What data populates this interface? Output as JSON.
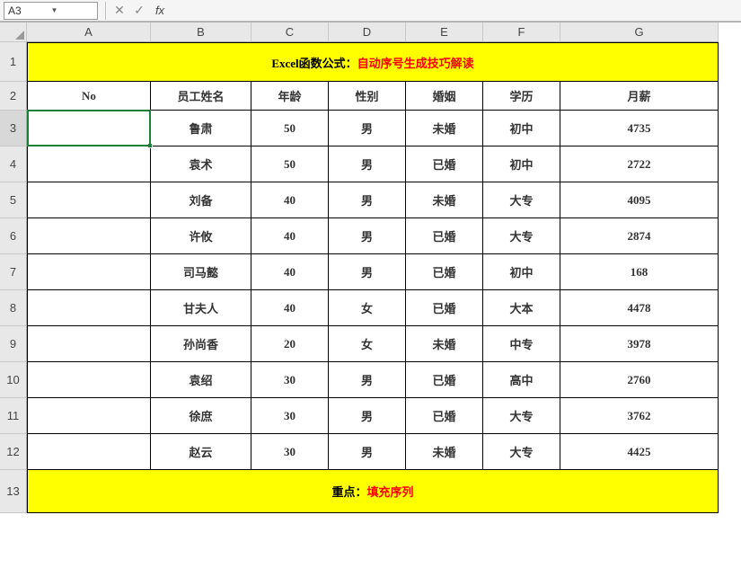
{
  "nameBox": "A3",
  "fxLabel": "fx",
  "formula": "",
  "colHeaders": [
    "A",
    "B",
    "C",
    "D",
    "E",
    "F",
    "G"
  ],
  "rowHeaders": [
    "1",
    "2",
    "3",
    "4",
    "5",
    "6",
    "7",
    "8",
    "9",
    "10",
    "11",
    "12",
    "13"
  ],
  "row1": {
    "prefix": "Excel函数公式：",
    "suffix": "自动序号生成技巧解读",
    "height": 44
  },
  "row2": {
    "height": 32,
    "cells": [
      "No",
      "员工姓名",
      "年龄",
      "性别",
      "婚姻",
      "学历",
      "月薪"
    ]
  },
  "dataRows": [
    {
      "h": 40,
      "cells": [
        "",
        "鲁肃",
        "50",
        "男",
        "未婚",
        "初中",
        "4735"
      ]
    },
    {
      "h": 40,
      "cells": [
        "",
        "袁术",
        "50",
        "男",
        "已婚",
        "初中",
        "2722"
      ]
    },
    {
      "h": 40,
      "cells": [
        "",
        "刘备",
        "40",
        "男",
        "未婚",
        "大专",
        "4095"
      ]
    },
    {
      "h": 40,
      "cells": [
        "",
        "许攸",
        "40",
        "男",
        "已婚",
        "大专",
        "2874"
      ]
    },
    {
      "h": 40,
      "cells": [
        "",
        "司马懿",
        "40",
        "男",
        "已婚",
        "初中",
        "168"
      ]
    },
    {
      "h": 40,
      "cells": [
        "",
        "甘夫人",
        "40",
        "女",
        "已婚",
        "大本",
        "4478"
      ]
    },
    {
      "h": 40,
      "cells": [
        "",
        "孙尚香",
        "20",
        "女",
        "未婚",
        "中专",
        "3978"
      ]
    },
    {
      "h": 40,
      "cells": [
        "",
        "袁绍",
        "30",
        "男",
        "已婚",
        "高中",
        "2760"
      ]
    },
    {
      "h": 40,
      "cells": [
        "",
        "徐庶",
        "30",
        "男",
        "已婚",
        "大专",
        "3762"
      ]
    },
    {
      "h": 40,
      "cells": [
        "",
        "赵云",
        "30",
        "男",
        "未婚",
        "大专",
        "4425"
      ]
    }
  ],
  "row13": {
    "prefix": "重点：",
    "suffix": "填充序列",
    "height": 48
  },
  "selectedCell": "A3",
  "chart_data": {
    "type": "table",
    "title": "Excel函数公式：自动序号生成技巧解读",
    "columns": [
      "No",
      "员工姓名",
      "年龄",
      "性别",
      "婚姻",
      "学历",
      "月薪"
    ],
    "rows": [
      [
        "",
        "鲁肃",
        50,
        "男",
        "未婚",
        "初中",
        4735
      ],
      [
        "",
        "袁术",
        50,
        "男",
        "已婚",
        "初中",
        2722
      ],
      [
        "",
        "刘备",
        40,
        "男",
        "未婚",
        "大专",
        4095
      ],
      [
        "",
        "许攸",
        40,
        "男",
        "已婚",
        "大专",
        2874
      ],
      [
        "",
        "司马懿",
        40,
        "男",
        "已婚",
        "初中",
        168
      ],
      [
        "",
        "甘夫人",
        40,
        "女",
        "已婚",
        "大本",
        4478
      ],
      [
        "",
        "孙尚香",
        20,
        "女",
        "未婚",
        "中专",
        3978
      ],
      [
        "",
        "袁绍",
        30,
        "男",
        "已婚",
        "高中",
        2760
      ],
      [
        "",
        "徐庶",
        30,
        "男",
        "已婚",
        "大专",
        3762
      ],
      [
        "",
        "赵云",
        30,
        "男",
        "未婚",
        "大专",
        4425
      ]
    ],
    "footer": "重点：填充序列"
  }
}
